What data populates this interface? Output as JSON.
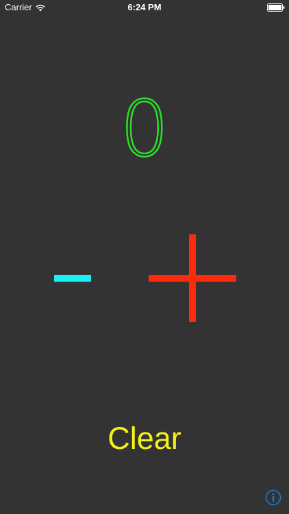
{
  "status_bar": {
    "carrier": "Carrier",
    "time": "6:24 PM",
    "wifi_icon": "wifi-icon",
    "battery_icon": "battery-icon"
  },
  "counter": {
    "value": "0",
    "color": "#2bde2b"
  },
  "controls": {
    "minus_icon": "minus-icon",
    "minus_color": "#19f0f5",
    "plus_icon": "plus-icon",
    "plus_color": "#ff2a0b",
    "clear_label": "Clear",
    "clear_color": "#f2f21a",
    "info_icon": "info-icon",
    "info_color": "#1e7ad9"
  },
  "colors": {
    "background": "#333333",
    "status_text": "#ffffff"
  }
}
